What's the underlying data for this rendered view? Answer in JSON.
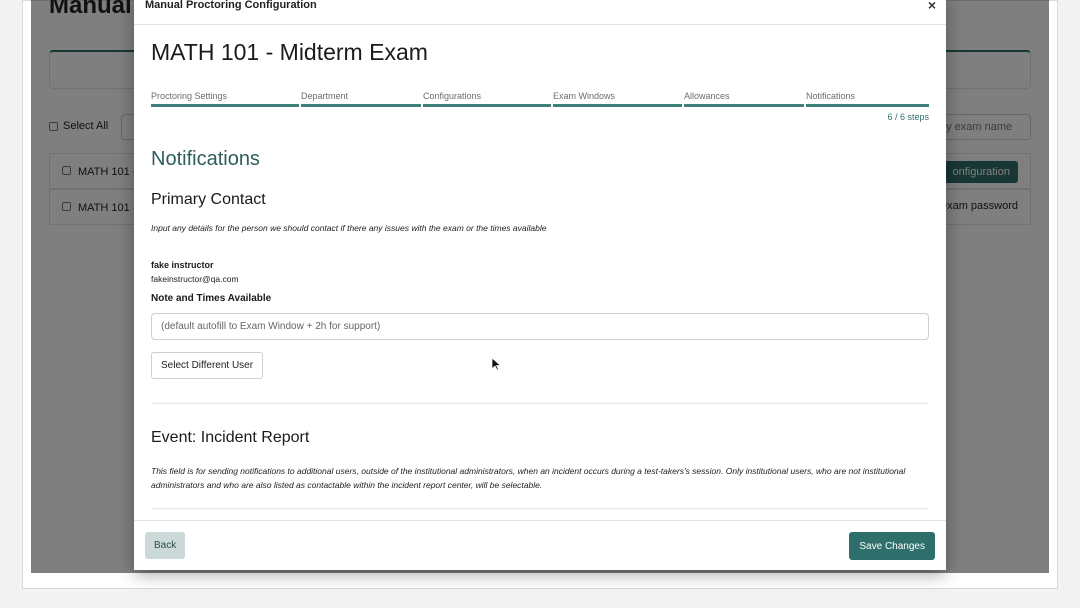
{
  "background": {
    "page_title": "Manual",
    "select_all": "Select All",
    "search_placeholder": "by exam name",
    "rows": [
      {
        "name": "MATH 101 -",
        "action": "onfiguration"
      },
      {
        "name": "MATH 101 -",
        "action": "exam password"
      }
    ]
  },
  "modal": {
    "title": "Manual Proctoring Configuration",
    "close_label": "×",
    "exam_title": "MATH 101 - Midterm Exam",
    "steps": [
      {
        "label": "Proctoring Settings"
      },
      {
        "label": "Department"
      },
      {
        "label": "Configurations"
      },
      {
        "label": "Exam Windows"
      },
      {
        "label": "Allowances"
      },
      {
        "label": "Notifications"
      }
    ],
    "step_count": "6 / 6 steps",
    "section_heading": "Notifications",
    "primary_contact": {
      "heading": "Primary Contact",
      "description": "Input any details for the person we should contact if there any issues with the exam or the times available",
      "name": "fake instructor",
      "email": "fakeinstructor@qa.com",
      "note_label": "Note and Times Available",
      "note_placeholder": "(default autofill to Exam Window + 2h for support)",
      "note_value": "",
      "select_user_label": "Select Different User"
    },
    "incident_report": {
      "heading": "Event: Incident Report",
      "description": "This field is for sending notifications to additional users, outside of the institutional administrators, when an incident occurs during a test-takers's session. Only institutional users, who are not institutional administrators and who are also listed as contactable within the incident report center, will be selectable."
    },
    "footer": {
      "back_label": "Back",
      "save_label": "Save Changes"
    }
  },
  "colors": {
    "accent": "#2f6f6b",
    "heading": "#2e5e5b",
    "back_bg": "#cbd9d8"
  }
}
